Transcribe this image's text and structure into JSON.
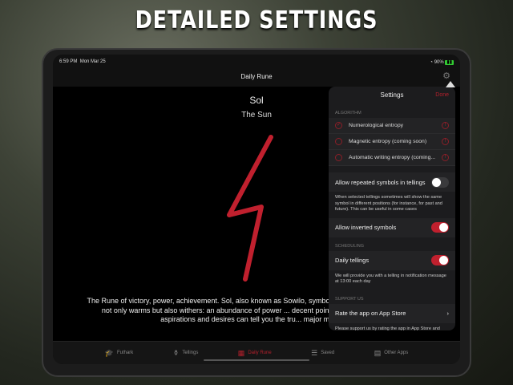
{
  "headline": "DETAILED SETTINGS",
  "status": {
    "time": "6:59 PM",
    "date": "Mon Mar 25",
    "battery": "90%"
  },
  "nav": {
    "title": "Daily Rune"
  },
  "rune": {
    "name": "Sol",
    "meaning": "The Sun",
    "description": "The Rune of victory, power, achievement. Sol, also known as Sowilo, symbolizes th... However the daylight not only warms but also withers: an abundance of power ... decent point. Only the integrity in your aspirations and desires can tell you the tru... major mistakes."
  },
  "tabs": [
    {
      "label": "Futhark",
      "icon": "🎓"
    },
    {
      "label": "Tellings",
      "icon": "⚱"
    },
    {
      "label": "Daily Rune",
      "icon": "▦"
    },
    {
      "label": "Saved",
      "icon": "☰"
    },
    {
      "label": "Other Apps",
      "icon": "▤"
    }
  ],
  "settings": {
    "title": "Settings",
    "done": "Done",
    "algorithm_header": "ALGORITHM",
    "algorithms": [
      {
        "label": "Numerological entropy",
        "selected": true
      },
      {
        "label": "Magnetic entropy (coming soon)",
        "selected": false
      },
      {
        "label": "Automatic writing entropy (coming...",
        "selected": false
      }
    ],
    "repeated": {
      "label": "Allow repeated symbols in tellings",
      "on": false,
      "note": "When selected tellings sometimes will show the same symbol in different positions (for instance, for past and future). This can be useful in some cases"
    },
    "inverted": {
      "label": "Allow inverted symbols",
      "on": true
    },
    "scheduling_header": "SCHEDULING",
    "daily": {
      "label": "Daily tellings",
      "on": true,
      "note": "We will provide you with a telling in notification message at 13:00 each day"
    },
    "support_header": "SUPPORT US",
    "rate": {
      "label": "Rate the app on App Store",
      "note": "Please support us by rating the app in App Store and writing a brief review"
    }
  },
  "colors": {
    "accent": "#b3202c"
  }
}
